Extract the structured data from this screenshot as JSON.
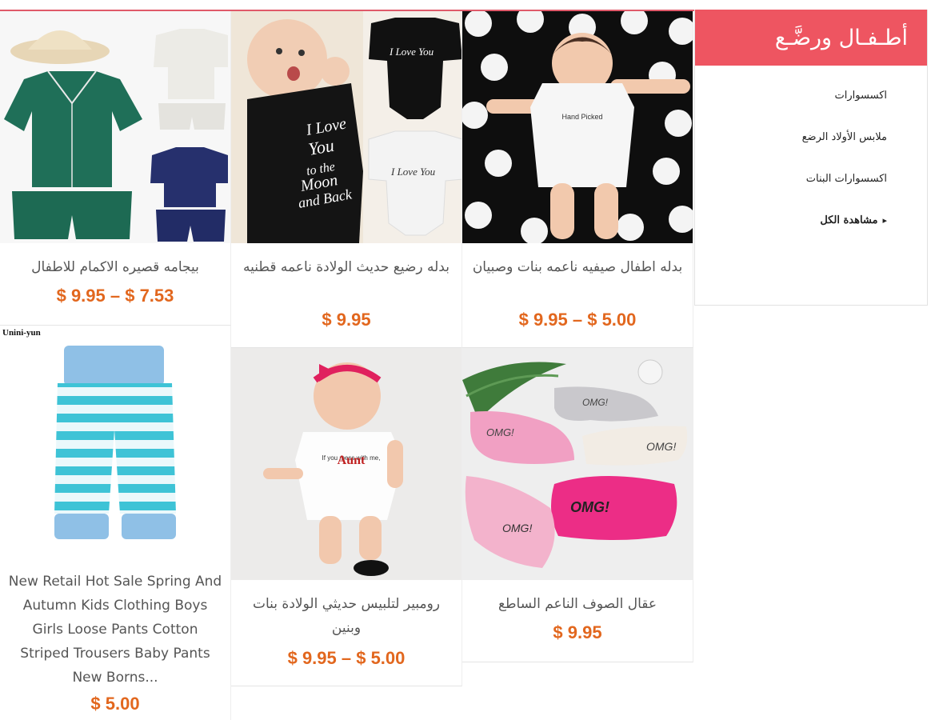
{
  "sidebar": {
    "title": "أطـفـال ورضَّـع",
    "items": [
      "اكسسوارات",
      "ملابس الأولاد الرضع",
      "اكسسوارات البنات"
    ],
    "view_all": "مشاهدة الكل"
  },
  "products": [
    {
      "name": "بيجامه قصيره الاكمام للاطفال",
      "price": "$ 9.95 – $ 7.53"
    },
    {
      "name": "بدله رضيع حديث الولادة ناعمه قطنيه",
      "price": "$ 9.95"
    },
    {
      "name": "بدله اطفال صيفيه ناعمه بنات وصبيان",
      "price": "$ 9.95 – $ 5.00"
    },
    {
      "name": "New Retail Hot Sale Spring And Autumn Kids Clothing Boys Girls Loose Pants Cotton Striped Trousers Baby Pants New Borns...",
      "price": "$ 5.00",
      "brand": "Unini-yun"
    },
    {
      "name": "رومبير لتلبيس حديثي الولادة بنات وبنين",
      "price": "$ 9.95 – $ 5.00"
    },
    {
      "name": "عقال الصوف الناعم الساطع",
      "price": "$ 9.95"
    }
  ],
  "image_text": {
    "onesie": [
      "I Love",
      "You",
      "to the",
      "Moon",
      "and Back"
    ],
    "aunt": "Aunt",
    "omg": "OMG!"
  },
  "colors": {
    "accent": "#ee5561",
    "price": "#e2671e"
  }
}
